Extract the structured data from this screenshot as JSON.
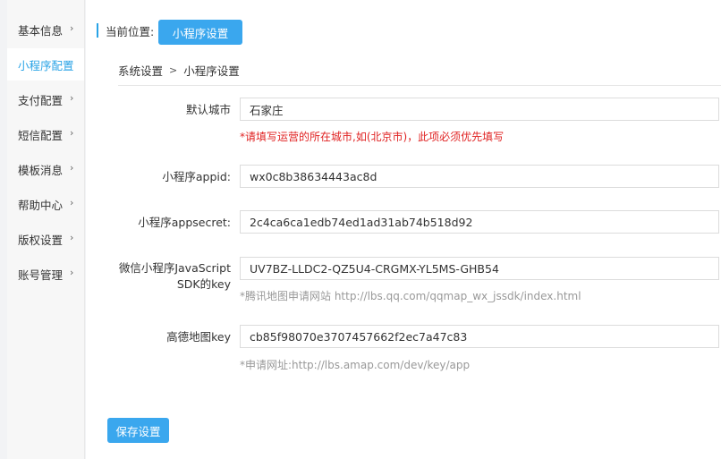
{
  "sidebar": {
    "items": [
      {
        "label": "基本信息",
        "chevron": "›"
      },
      {
        "label": "小程序配置",
        "chevron": ""
      },
      {
        "label": "支付配置",
        "chevron": "›"
      },
      {
        "label": "短信配置",
        "chevron": "›"
      },
      {
        "label": "模板消息",
        "chevron": "›"
      },
      {
        "label": "帮助中心",
        "chevron": "›"
      },
      {
        "label": "版权设置",
        "chevron": "›"
      },
      {
        "label": "账号管理",
        "chevron": "›"
      }
    ],
    "active_index": 1
  },
  "location": {
    "label": "当前位置:",
    "button": "小程序设置"
  },
  "breadcrumb": {
    "parent": "系统设置",
    "separator": ">",
    "current": "小程序设置"
  },
  "form": {
    "default_city": {
      "label": "默认城市",
      "value": "石家庄",
      "hint": "*请填写运营的所在城市,如(北京市)，此项必须优先填写"
    },
    "appid": {
      "label": "小程序appid:",
      "value": "wx0c8b38634443ac8d"
    },
    "appsecret": {
      "label": "小程序appsecret:",
      "value": "2c4ca6ca1edb74ed1ad31ab74b518d92"
    },
    "js_sdk_key": {
      "label_line1": "微信小程序JavaScript",
      "label_line2": "SDK的key",
      "value": "UV7BZ-LLDC2-QZ5U4-CRGMX-YL5MS-GHB54",
      "hint": "*腾讯地图申请网站 http://lbs.qq.com/qqmap_wx_jssdk/index.html"
    },
    "amap_key": {
      "label": "高德地图key",
      "value": "cb85f98070e3707457662f2ec7a47c83",
      "hint": "*申请网址:http://lbs.amap.com/dev/key/app"
    }
  },
  "actions": {
    "save_label": "保存设置"
  },
  "colors": {
    "accent": "#3aa7ee",
    "warning": "#e02222"
  }
}
